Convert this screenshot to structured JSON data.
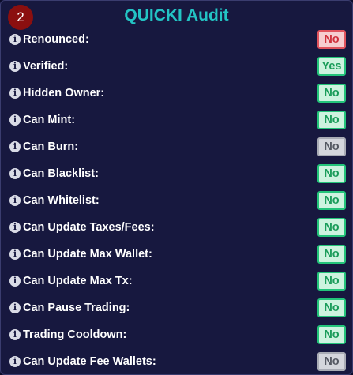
{
  "header": {
    "step_number": "2",
    "title": "QUICKI Audit"
  },
  "info_icon_glyph": "i",
  "status_colors": {
    "green": "#23c47a",
    "red": "#e0535d",
    "gray": "#a9acb5"
  },
  "rows": [
    {
      "label": "Renounced:",
      "value": "No",
      "status": "red"
    },
    {
      "label": "Verified:",
      "value": "Yes",
      "status": "green"
    },
    {
      "label": "Hidden Owner:",
      "value": "No",
      "status": "green"
    },
    {
      "label": "Can Mint:",
      "value": "No",
      "status": "green"
    },
    {
      "label": "Can Burn:",
      "value": "No",
      "status": "gray"
    },
    {
      "label": "Can Blacklist:",
      "value": "No",
      "status": "green"
    },
    {
      "label": "Can Whitelist:",
      "value": "No",
      "status": "green"
    },
    {
      "label": "Can Update Taxes/Fees:",
      "value": "No",
      "status": "green"
    },
    {
      "label": "Can Update Max Wallet:",
      "value": "No",
      "status": "green"
    },
    {
      "label": "Can Update Max Tx:",
      "value": "No",
      "status": "green"
    },
    {
      "label": "Can Pause Trading:",
      "value": "No",
      "status": "green"
    },
    {
      "label": "Trading Cooldown:",
      "value": "No",
      "status": "green"
    },
    {
      "label": "Can Update Fee Wallets:",
      "value": "No",
      "status": "gray"
    }
  ]
}
